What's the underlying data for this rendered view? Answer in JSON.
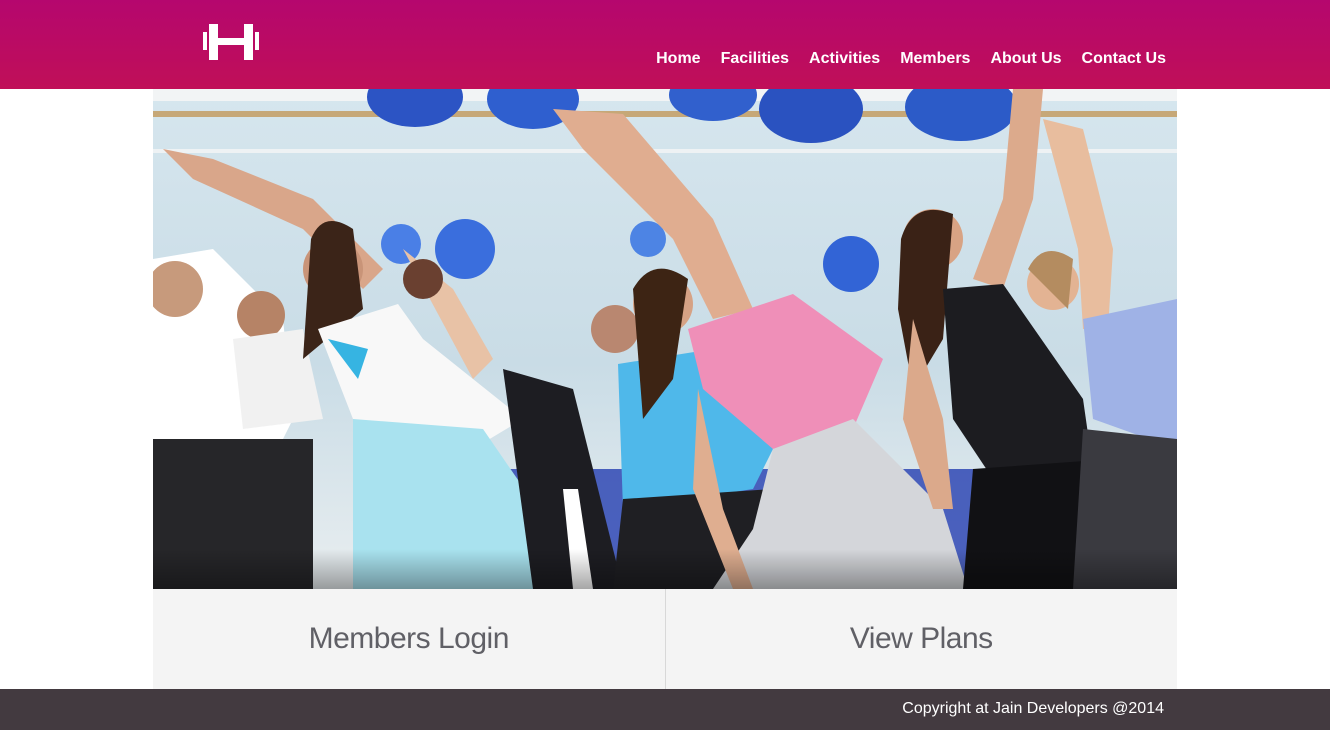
{
  "brand": {
    "logo_icon": "dumbbell-icon",
    "header_color": "#b5076e",
    "footer_color": "#433a40"
  },
  "nav": {
    "items": [
      {
        "label": "Home"
      },
      {
        "label": "Facilities"
      },
      {
        "label": "Activities"
      },
      {
        "label": "Members"
      },
      {
        "label": "About Us"
      },
      {
        "label": "Contact Us"
      }
    ]
  },
  "hero": {
    "image": "group-fitness-class-photo"
  },
  "panels": {
    "login_label": "Members Login",
    "plans_label": "View Plans"
  },
  "footer": {
    "copyright": "Copyright at Jain Developers @2014"
  }
}
